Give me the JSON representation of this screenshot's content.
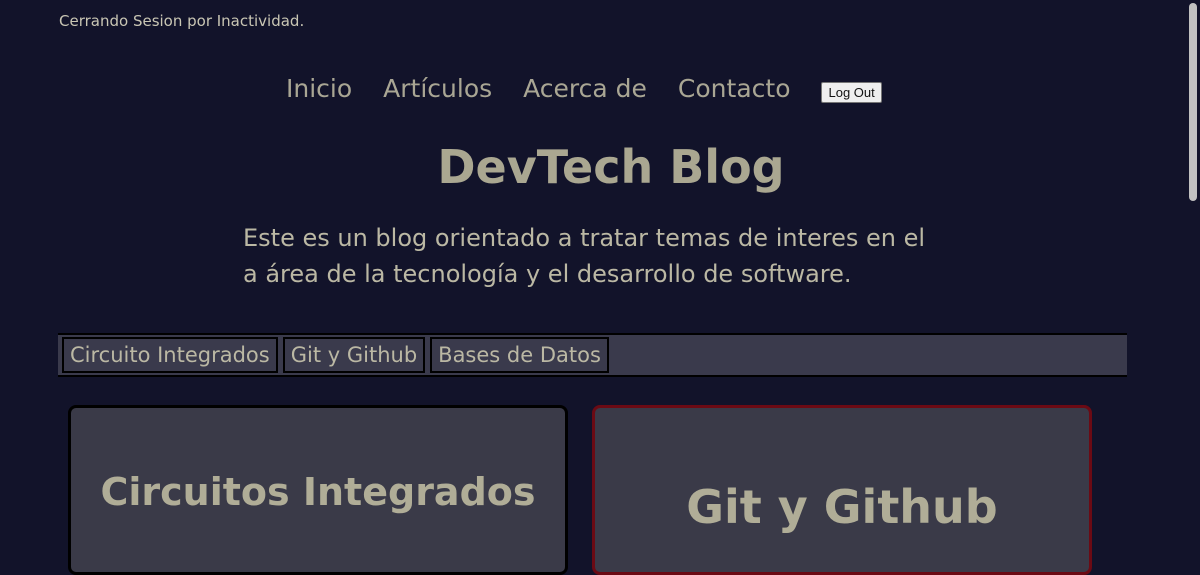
{
  "status": {
    "message": "Cerrando Sesion por Inactividad."
  },
  "nav": {
    "items": [
      "Inicio",
      "Artículos",
      "Acerca de",
      "Contacto"
    ],
    "logout_label": "Log Out"
  },
  "hero": {
    "title": "DevTech Blog",
    "description": "Este es un blog orientado a tratar temas de interes en el a área de la tecnología y el desarrollo de software."
  },
  "categories": [
    "Circuito Integrados",
    "Git y Github",
    "Bases de Datos"
  ],
  "cards": [
    {
      "title": "Circuitos Integrados",
      "border_color": "#000000"
    },
    {
      "title": "Git y Github",
      "border_color": "#6b0a14"
    }
  ],
  "colors": {
    "background": "#12132a",
    "panel": "#3a3a4c",
    "text": "#b4b19c"
  }
}
